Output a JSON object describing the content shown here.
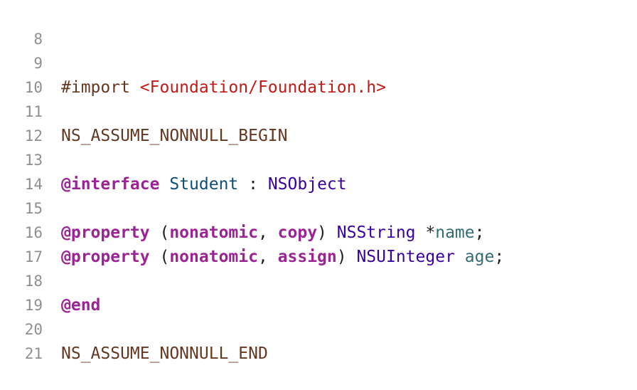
{
  "editor": {
    "lines": [
      {
        "num": "8"
      },
      {
        "num": "9",
        "tokens": {
          "directive": "#import ",
          "path": "<Foundation/Foundation.h>"
        }
      },
      {
        "num": "10"
      },
      {
        "num": "11",
        "tokens": {
          "macro": "NS_ASSUME_NONNULL_BEGIN"
        }
      },
      {
        "num": "12"
      },
      {
        "num": "13",
        "tokens": {
          "kw": "@interface",
          "sp1": " ",
          "name": "Student",
          "colon": " : ",
          "super": "NSObject"
        }
      },
      {
        "num": "14"
      },
      {
        "num": "15",
        "tokens": {
          "kw": "@property",
          "open": " (",
          "attr1": "nonatomic",
          "comma": ", ",
          "attr2": "copy",
          "close": ") ",
          "type": "NSString",
          "star": " *",
          "prop": "name",
          "semi": ";"
        }
      },
      {
        "num": "16",
        "tokens": {
          "kw": "@property",
          "open": " (",
          "attr1": "nonatomic",
          "comma": ", ",
          "attr2": "assign",
          "close": ") ",
          "type": "NSUInteger",
          "sp": " ",
          "prop": "age",
          "semi": ";"
        }
      },
      {
        "num": "17"
      },
      {
        "num": "18",
        "tokens": {
          "kw": "@end"
        }
      },
      {
        "num": "19"
      },
      {
        "num": "20",
        "tokens": {
          "macro": "NS_ASSUME_NONNULL_END"
        }
      },
      {
        "num": "21"
      }
    ]
  },
  "colors": {
    "keyword": "#9b2393",
    "macro": "#643820",
    "string": "#c41a16",
    "class": "#3900a0",
    "declaration": "#0b4f79",
    "property": "#326d74",
    "line_number": "#8e8e93",
    "background": "#ffffff"
  }
}
